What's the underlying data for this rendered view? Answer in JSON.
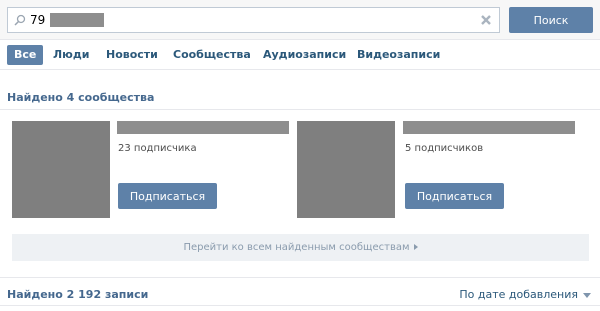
{
  "search": {
    "query": "79",
    "search_button_label": "Поиск"
  },
  "tabs": [
    {
      "label": "Все",
      "active": true
    },
    {
      "label": "Люди"
    },
    {
      "label": "Новости"
    },
    {
      "label": "Сообщества"
    },
    {
      "label": "Аудиозаписи"
    },
    {
      "label": "Видеозаписи"
    }
  ],
  "communities_section": {
    "title": "Найдено 4 сообщества",
    "items": [
      {
        "subscribers": "23 подписчика",
        "button_label": "Подписаться"
      },
      {
        "subscribers": "5 подписчиков",
        "button_label": "Подписаться"
      }
    ],
    "see_all_label": "Перейти ко всем найденным сообществам"
  },
  "posts_section": {
    "title": "Найдено 2 192 записи",
    "sort_label": "По дате добавления"
  },
  "colors": {
    "accent": "#5e81a8",
    "link": "#2b587a",
    "heading": "#45688e"
  }
}
